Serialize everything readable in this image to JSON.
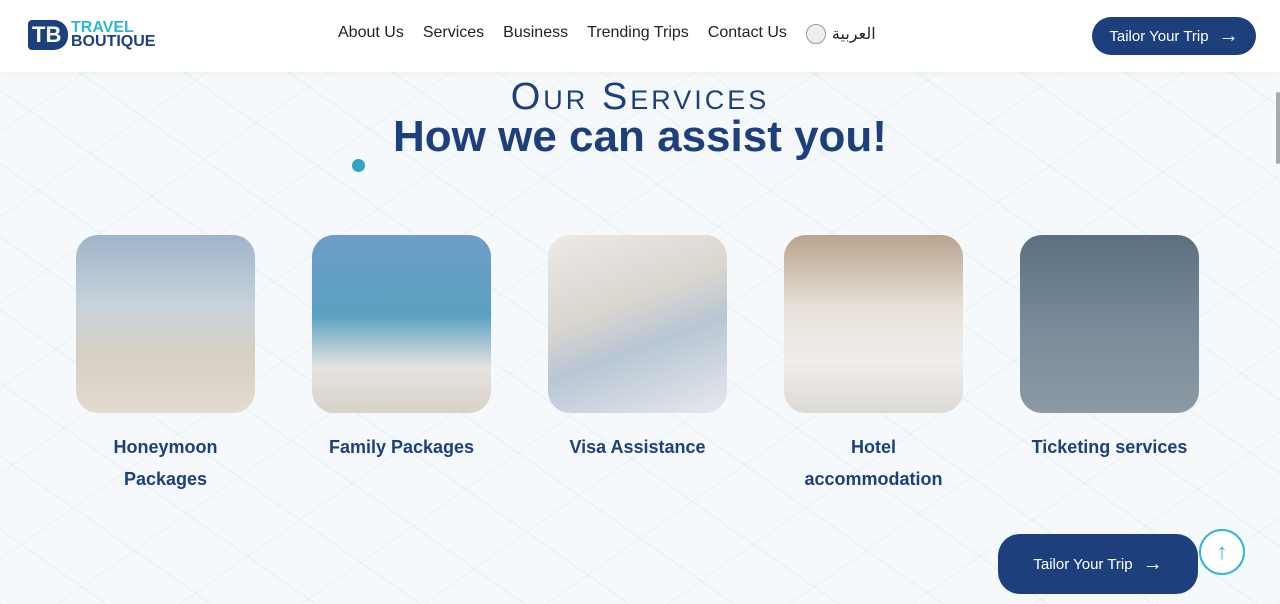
{
  "brand": {
    "line1": "TRAVEL",
    "line2": "BOUTIQUE",
    "mark": "TB"
  },
  "nav": [
    "About Us",
    "Services",
    "Business",
    "Trending Trips",
    "Contact Us"
  ],
  "language": "العربية",
  "cta": "Tailor Your Trip",
  "section": {
    "eyebrow": "Our Services",
    "title": "How we can assist you!"
  },
  "services": [
    {
      "label": "Honeymoon Packages"
    },
    {
      "label": "Family Packages"
    },
    {
      "label": "Visa Assistance"
    },
    {
      "label": "Hotel accommodation"
    },
    {
      "label": "Ticketing services"
    }
  ],
  "scroll_progress": 0.1
}
